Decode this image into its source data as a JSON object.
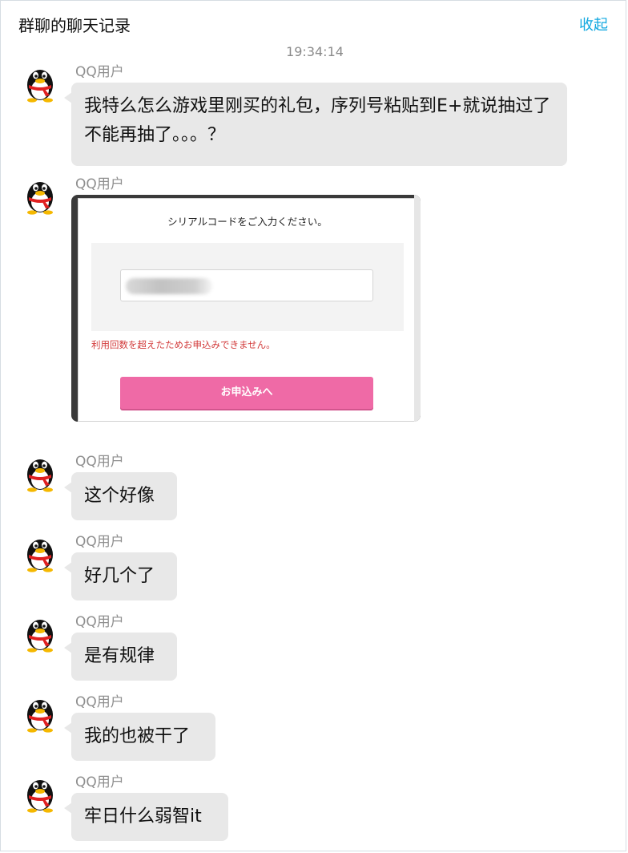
{
  "header": {
    "title": "群聊的聊天记录",
    "collapse_label": "收起"
  },
  "timestamp": "19:34:14",
  "messages": [
    {
      "sender": "QQ用户",
      "text": "我特么怎么游戏里刚买的礼包，序列号粘贴到E+就说抽过了不能再抽了。。。？"
    },
    {
      "sender": "QQ用户",
      "image": {
        "prompt": "シリアルコードをご入力ください。",
        "input_value": "",
        "error": "利用回数を超えたためお申込みできません。",
        "button": "お申込みへ"
      }
    },
    {
      "sender": "QQ用户",
      "text": "这个好像"
    },
    {
      "sender": "QQ用户",
      "text": "好几个了"
    },
    {
      "sender": "QQ用户",
      "text": "是有规律"
    },
    {
      "sender": "QQ用户",
      "text": "我的也被干了"
    },
    {
      "sender": "QQ用户",
      "text": "牢日什么弱智it"
    }
  ],
  "icons": {
    "avatar": "qq-penguin-avatar-icon"
  },
  "colors": {
    "accent": "#12a8e0",
    "bubble": "#e8e8e8",
    "error": "#d23a3a",
    "button": "#ef6aa6"
  }
}
